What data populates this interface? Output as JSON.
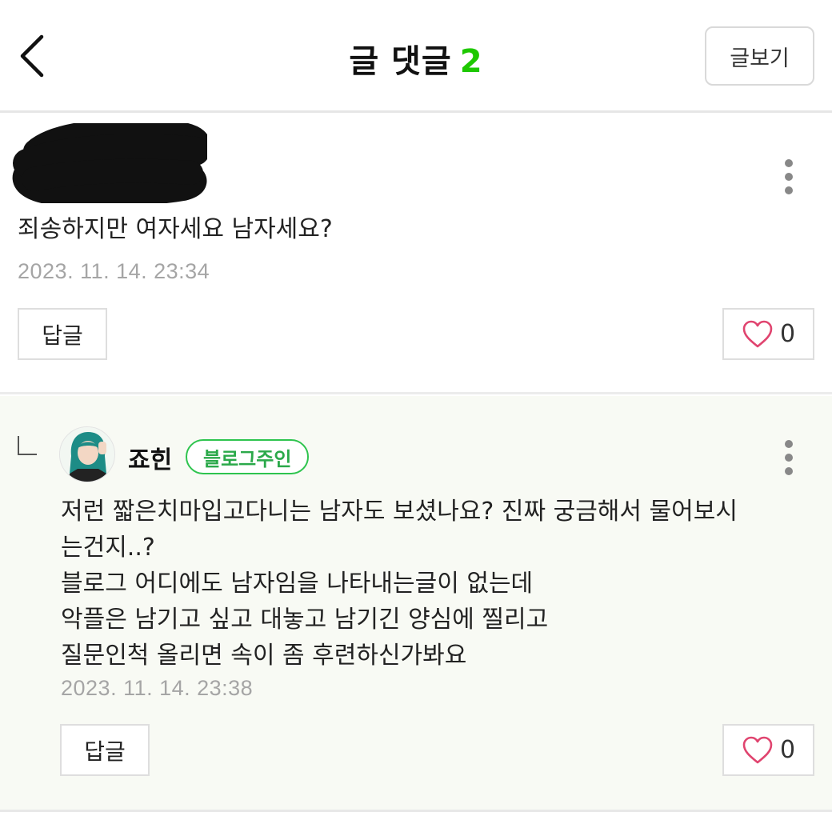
{
  "header": {
    "back_icon": "chevron-left-icon",
    "title": "글 댓글",
    "count": "2",
    "view_post_label": "글보기",
    "accent_color": "#1ec800"
  },
  "comments": [
    {
      "author": "",
      "author_redacted": true,
      "text": "죄송하지만 여자세요 남자세요?",
      "date": "2023. 11. 14. 23:34",
      "reply_label": "답글",
      "like_count": "0",
      "more_icon": "more-vertical-icon"
    },
    {
      "author": "죠힌",
      "badge": "블로그주인",
      "is_reply": true,
      "text": "저런 짧은치마입고다니는 남자도 보셨나요? 진짜 궁금해서 물어보시\n는건지..?\n블로그 어디에도 남자임을 나타내는글이 없는데\n악플은 남기고 싶고 대놓고 남기긴 양심에 찔리고\n질문인척 올리면 속이 좀 후련하신가봐요",
      "date": "2023. 11. 14. 23:38",
      "reply_label": "답글",
      "like_count": "0",
      "more_icon": "more-vertical-icon",
      "badge_color": "#2ec44e"
    }
  ]
}
